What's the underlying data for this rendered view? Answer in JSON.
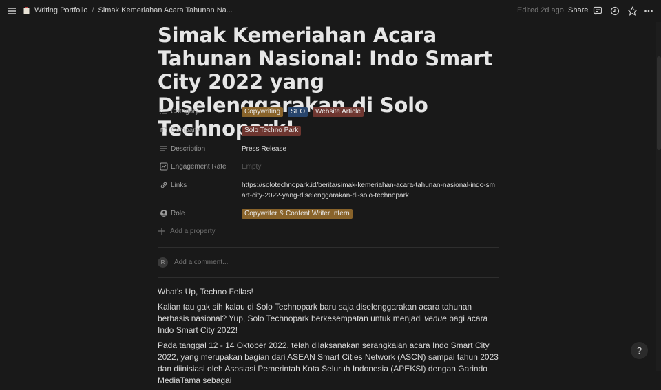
{
  "topbar": {
    "breadcrumb_root": "Writing Portfolio",
    "breadcrumb_sep": "/",
    "breadcrumb_page": "Simak Kemeriahan Acara Tahunan Na...",
    "edited": "Edited 2d ago",
    "share_label": "Share"
  },
  "page": {
    "title": "Simak Kemeriahan Acara Tahunan Nasional: Indo Smart City 2022 yang Diselenggarakan di Solo Technopark!"
  },
  "properties": {
    "category": {
      "name": "Category",
      "tags": [
        "Copywriting",
        "SEO",
        "Website Article"
      ]
    },
    "company": {
      "name": "Company",
      "tags": [
        "Solo Techno Park"
      ]
    },
    "description": {
      "name": "Description",
      "value": "Press Release"
    },
    "engagement": {
      "name": "Engagement Rate",
      "value": "Empty"
    },
    "links": {
      "name": "Links",
      "value": "https://solotechnopark.id/berita/simak-kemeriahan-acara-tahunan-nasional-indo-smart-city-2022-yang-diselenggarakan-di-solo-technopark"
    },
    "role": {
      "name": "Role",
      "tags": [
        "Copywriter & Content Writer Intern"
      ]
    },
    "add_property": "Add a property"
  },
  "comment": {
    "avatar_initial": "R",
    "placeholder": "Add a comment..."
  },
  "body": {
    "p1": "What's Up, Techno Fellas!",
    "p2_a": "Kalian tau gak sih kalau di Solo Technopark baru saja diselenggarakan acara tahunan berbasis nasional? Yup, Solo Technopark berkesempatan untuk menjadi ",
    "p2_em": "venue",
    "p2_b": " bagi acara Indo Smart City 2022!",
    "p3": "Pada tanggal 12 - 14 Oktober 2022, telah dilaksanakan serangkaian acara Indo Smart City 2022, yang merupakan bagian dari ASEAN Smart Cities Network (ASCN) sampai tahun 2023 dan diinisiasi oleh Asosiasi Pemerintah Kota Seluruh Indonesia (APEKSI) dengan Garindo MediaTama sebagai"
  },
  "help_label": "?",
  "colors": {
    "background": "#191919",
    "tag_brown": "#89632a",
    "tag_blue": "#28456c",
    "tag_red": "#6e3630"
  },
  "icons": [
    "menu-icon",
    "page-icon",
    "comment-icon",
    "clock-icon",
    "star-icon",
    "more-icon",
    "list-icon",
    "bank-icon",
    "text-icon",
    "chart-icon",
    "link-icon",
    "person-icon",
    "plus-icon"
  ]
}
